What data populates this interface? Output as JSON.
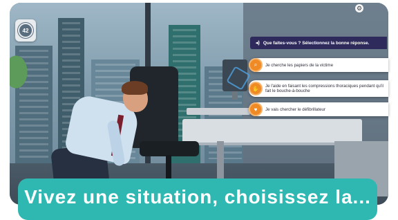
{
  "scene": {
    "timer_icon": "stopwatch-icon",
    "timer_value": "42",
    "settings_icon": "gear-icon",
    "settings_glyph": "⚙"
  },
  "question": {
    "icon": "speaker-icon",
    "icon_glyph": "◂)",
    "text": "Que faites-vous ? Sélectionnez la bonne réponse."
  },
  "answers": [
    {
      "icon": "search-icon",
      "icon_glyph": "⌕",
      "text": "Je cherche les papiers de la victime"
    },
    {
      "icon": "hands-icon",
      "icon_glyph": "✋",
      "text": "Je l'aide en faisant les compressions thoraciques pendant qu'il fait le bouche-à-bouche"
    },
    {
      "icon": "heart-icon",
      "icon_glyph": "♥",
      "text": "Je vais chercher le défibrillateur"
    }
  ],
  "banner": {
    "text": "Vivez une situation, choisissez la..."
  },
  "colors": {
    "accent_teal": "#2fb8b1",
    "question_bg": "#2e2a5c",
    "answer_bullet": "#f08a24"
  }
}
